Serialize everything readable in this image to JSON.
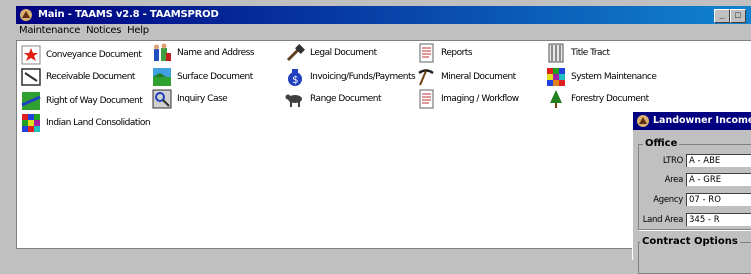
{
  "main_window": {
    "title": "Main - TAAMS v2.8 - TAAMSPROD",
    "menu": [
      "Maintenance",
      "Notices",
      "Help"
    ]
  },
  "menu_items": [
    {
      "label": "Conveyance Document",
      "icon": "conveyance-icon"
    },
    {
      "label": "Name and Address",
      "icon": "name-address-icon"
    },
    {
      "label": "Legal Document",
      "icon": "legal-document-icon"
    },
    {
      "label": "Reports",
      "icon": "reports-icon"
    },
    {
      "label": "Title Tract",
      "icon": "title-tract-icon"
    },
    {
      "label": "Receivable Document",
      "icon": "receivable-icon"
    },
    {
      "label": "Surface Document",
      "icon": "surface-icon"
    },
    {
      "label": "Invoicing/Funds/Payments",
      "icon": "money-bag-icon"
    },
    {
      "label": "Mineral Document",
      "icon": "pickaxe-icon"
    },
    {
      "label": "System Maintenance",
      "icon": "system-maintenance-icon"
    },
    {
      "label": "Right of Way Document",
      "icon": "right-of-way-icon"
    },
    {
      "label": "Inquiry Case",
      "icon": "inquiry-icon"
    },
    {
      "label": "Range Document",
      "icon": "cow-icon"
    },
    {
      "label": "Imaging / Workflow",
      "icon": "imaging-icon"
    },
    {
      "label": "Forestry Document",
      "icon": "tree-icon"
    },
    {
      "label": "Indian Land Consolidation",
      "icon": "land-consolidation-icon"
    }
  ],
  "dialog": {
    "title": "Landowner Income Re",
    "office_group": "Office",
    "fields": [
      {
        "label": "LTRO",
        "value": "A - ABE"
      },
      {
        "label": "Area",
        "value": "A - GRE"
      },
      {
        "label": "Agency",
        "value": "07 - RO"
      },
      {
        "label": "Land Area",
        "value": "345 - R"
      }
    ],
    "contract_group": "Contract Options"
  },
  "colors": {
    "titlebar": "#000080",
    "face": "#c0c0c0"
  }
}
